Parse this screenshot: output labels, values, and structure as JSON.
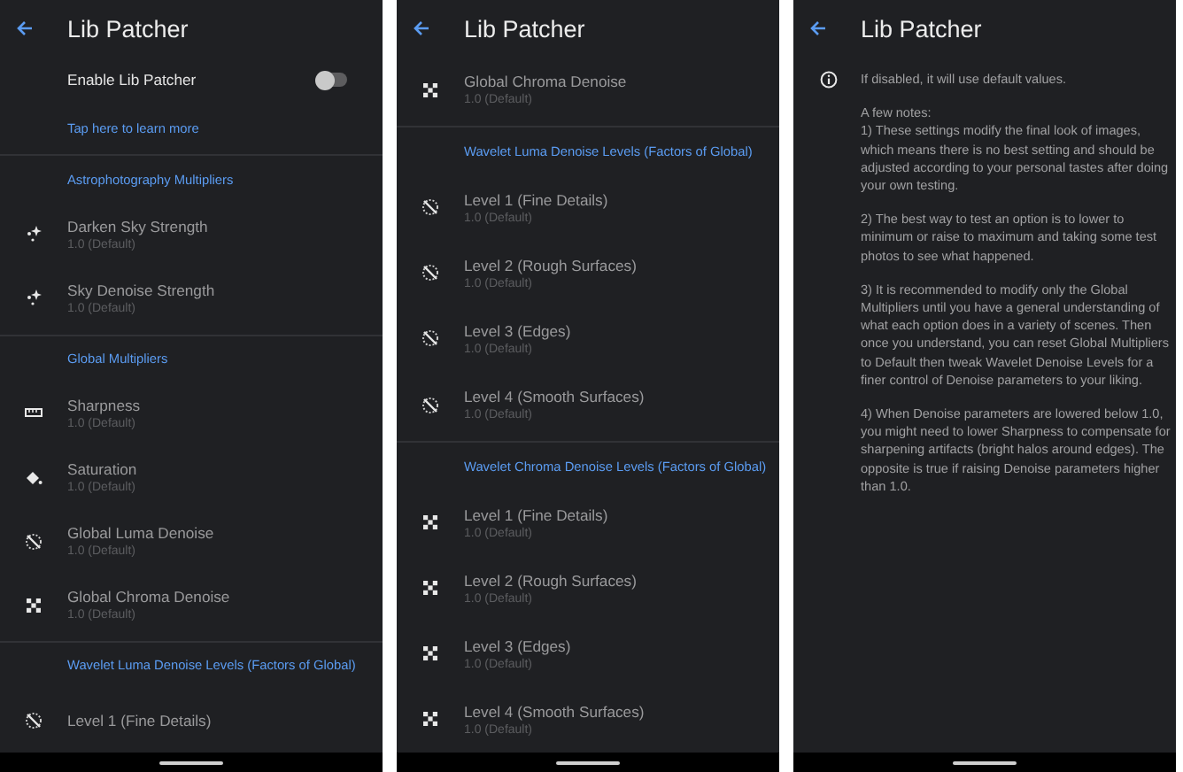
{
  "screens": [
    {
      "title": "Lib Patcher",
      "items": [
        {
          "kind": "toggle",
          "label": "Enable Lib Patcher",
          "on": false
        },
        {
          "kind": "link",
          "label": "Tap here to learn more"
        },
        {
          "kind": "header",
          "label": "Astrophotography Multipliers"
        },
        {
          "kind": "stars",
          "label": "Darken Sky Strength",
          "value": "1.0 (Default)"
        },
        {
          "kind": "stars",
          "label": "Sky Denoise Strength",
          "value": "1.0 (Default)"
        },
        {
          "kind": "header",
          "label": "Global Multipliers"
        },
        {
          "kind": "ruler",
          "label": "Sharpness",
          "value": "1.0 (Default)"
        },
        {
          "kind": "bucket",
          "label": "Saturation",
          "value": "1.0 (Default)"
        },
        {
          "kind": "luma",
          "label": "Global Luma Denoise",
          "value": "1.0 (Default)"
        },
        {
          "kind": "chroma",
          "label": "Global Chroma Denoise",
          "value": "1.0 (Default)"
        },
        {
          "kind": "header",
          "label": "Wavelet Luma Denoise Levels (Factors of Global)"
        },
        {
          "kind": "luma",
          "label": "Level 1 (Fine Details)"
        }
      ]
    },
    {
      "title": "Lib Patcher",
      "items": [
        {
          "kind": "chroma",
          "label": "Global Chroma Denoise",
          "value": "1.0 (Default)"
        },
        {
          "kind": "header",
          "label": "Wavelet Luma Denoise Levels (Factors of Global)"
        },
        {
          "kind": "luma",
          "label": "Level 1 (Fine Details)",
          "value": "1.0 (Default)"
        },
        {
          "kind": "luma",
          "label": "Level 2 (Rough Surfaces)",
          "value": "1.0 (Default)"
        },
        {
          "kind": "luma",
          "label": "Level 3 (Edges)",
          "value": "1.0 (Default)"
        },
        {
          "kind": "luma",
          "label": "Level 4 (Smooth Surfaces)",
          "value": "1.0 (Default)"
        },
        {
          "kind": "header",
          "label": "Wavelet Chroma Denoise Levels (Factors of Global)"
        },
        {
          "kind": "chroma",
          "label": "Level 1 (Fine Details)",
          "value": "1.0 (Default)"
        },
        {
          "kind": "chroma",
          "label": "Level 2 (Rough Surfaces)",
          "value": "1.0 (Default)"
        },
        {
          "kind": "chroma",
          "label": "Level 3 (Edges)",
          "value": "1.0 (Default)"
        },
        {
          "kind": "chroma",
          "label": "Level 4 (Smooth Surfaces)",
          "value": "1.0 (Default)"
        }
      ]
    },
    {
      "title": "Lib Patcher",
      "items": [
        {
          "kind": "info",
          "paragraphs": [
            "If disabled, it will use default values.",
            "A few notes:\n1) These settings modify the final look of images, which means there is no best setting and should be adjusted according to your personal tastes after doing your own testing.",
            "2) The best way to test an option is to lower to minimum or raise to maximum and taking some test photos to see what happened.",
            "3) It is recommended to modify only the Global Multipliers until you have a general understanding of what each option does in a variety of scenes. Then once you understand, you can reset Global Multipliers to Default then tweak Wavelet Denoise Levels for a finer control of Denoise parameters to your liking.",
            "4) When Denoise parameters are lowered below 1.0, you might need to lower Sharpness to compensate for sharpening artifacts (bright halos around edges). The opposite is true if raising Denoise parameters higher than 1.0."
          ]
        }
      ]
    }
  ]
}
